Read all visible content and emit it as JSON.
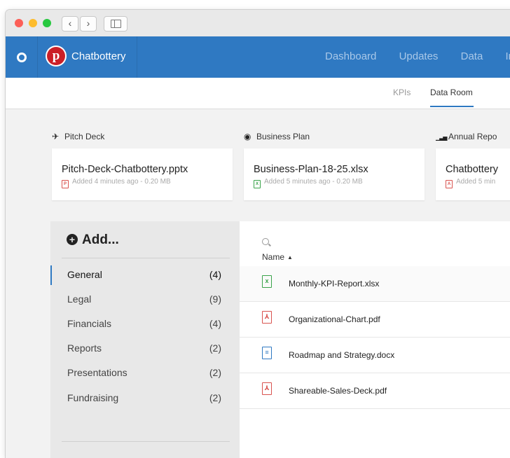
{
  "browser": {
    "back_glyph": "‹",
    "forward_glyph": "›"
  },
  "topnav": {
    "brand_name": "Chatbottery",
    "brand_letter": "p",
    "menu": [
      "Dashboard",
      "Updates",
      "Data",
      "In"
    ]
  },
  "subnav": {
    "tabs": [
      "KPIs",
      "Data Room"
    ],
    "active": "Data Room"
  },
  "featured": [
    {
      "category": "Pitch Deck",
      "icon": "plane-icon",
      "icon_glyph": "✈",
      "file": "Pitch-Deck-Chatbottery.pptx",
      "meta": "Added 4 minutes ago - 0.20 MB",
      "type_color": "red",
      "type_glyph": "P"
    },
    {
      "category": "Business Plan",
      "icon": "dashboard-icon",
      "icon_glyph": "◉",
      "file": "Business-Plan-18-25.xlsx",
      "meta": "Added 5 minutes ago - 0.20 MB",
      "type_color": "green",
      "type_glyph": "X"
    },
    {
      "category": "Annual Repo",
      "icon": "bar-chart-icon",
      "icon_glyph": "▁▃▅",
      "file": "Chatbottery",
      "meta": "Added 5 min",
      "type_color": "red",
      "type_glyph": "A"
    }
  ],
  "sidebar": {
    "add_label": "Add...",
    "folders": [
      {
        "name": "General",
        "count": "(4)"
      },
      {
        "name": "Legal",
        "count": "(9)"
      },
      {
        "name": "Financials",
        "count": "(4)"
      },
      {
        "name": "Reports",
        "count": "(2)"
      },
      {
        "name": "Presentations",
        "count": "(2)"
      },
      {
        "name": "Fundraising",
        "count": "(2)"
      }
    ],
    "active": "General"
  },
  "files": {
    "column_name": "Name",
    "sort_glyph": "▲",
    "rows": [
      {
        "name": "Monthly-KPI-Report.xlsx",
        "icon": "excel-file-icon",
        "color": "green",
        "glyph": "x"
      },
      {
        "name": "Organizational-Chart.pdf",
        "icon": "pdf-file-icon",
        "color": "red",
        "glyph": "⅄"
      },
      {
        "name": "Roadmap and Strategy.docx",
        "icon": "word-file-icon",
        "color": "blue",
        "glyph": "≡"
      },
      {
        "name": "Shareable-Sales-Deck.pdf",
        "icon": "pdf-file-icon",
        "color": "red",
        "glyph": "⅄"
      }
    ]
  }
}
